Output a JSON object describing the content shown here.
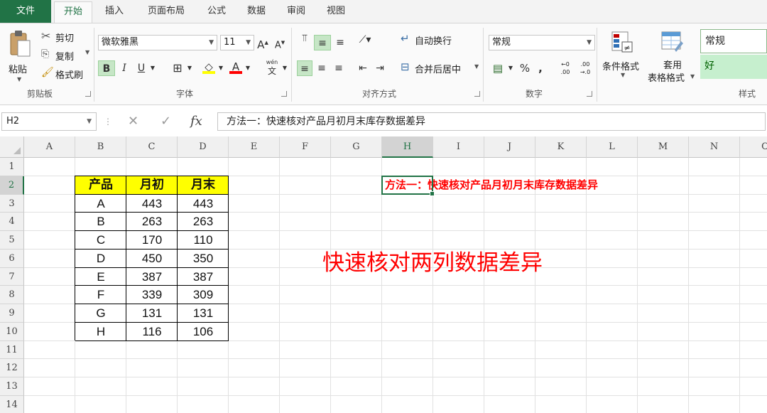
{
  "ribbon_tabs": [
    {
      "label": "文件"
    },
    {
      "label": "开始"
    },
    {
      "label": "插入"
    },
    {
      "label": "页面布局"
    },
    {
      "label": "公式"
    },
    {
      "label": "数据"
    },
    {
      "label": "审阅"
    },
    {
      "label": "视图"
    }
  ],
  "active_tab": "开始",
  "clipboard": {
    "paste": "粘贴",
    "cut": "剪切",
    "copy": "复制",
    "format_painter": "格式刷",
    "group": "剪贴板"
  },
  "font": {
    "name": "微软雅黑",
    "size": "11",
    "grow": "A",
    "shrink": "A",
    "bold": "B",
    "italic": "I",
    "underline": "U",
    "font_color_glyph": "A",
    "phonetic_top": "wén",
    "phonetic_bottom": "文",
    "group": "字体"
  },
  "alignment": {
    "wrap_text": "自动换行",
    "merge_center": "合并后居中",
    "group": "对齐方式"
  },
  "number": {
    "format": "常规",
    "percent": "%",
    "comma": ",",
    "inc_decimal_top": "←0",
    "inc_decimal_bottom": ".00",
    "dec_decimal_top": ".00",
    "dec_decimal_bottom": "→.0",
    "group": "数字"
  },
  "styles": {
    "conditional_format": "条件格式",
    "format_table_1": "套用",
    "format_table_2": "表格格式",
    "style_normal": "常规",
    "style_good": "好",
    "group": "样式"
  },
  "formula_bar": {
    "name_box": "H2",
    "cancel": "✕",
    "enter": "✓",
    "fx": "fx",
    "content": "方法一：快速核对产品月初月末库存数据差异"
  },
  "columns": [
    "A",
    "B",
    "C",
    "D",
    "E",
    "F",
    "G",
    "H",
    "I",
    "J",
    "K",
    "L",
    "M",
    "N",
    "O"
  ],
  "rows": [
    "1",
    "2",
    "3",
    "4",
    "5",
    "6",
    "7",
    "8",
    "9",
    "10",
    "11",
    "12",
    "13",
    "14"
  ],
  "selected_column": "H",
  "selected_row": "2",
  "table": {
    "headers": [
      "产品",
      "月初",
      "月末"
    ],
    "rows": [
      [
        "A",
        "443",
        "443"
      ],
      [
        "B",
        "263",
        "263"
      ],
      [
        "C",
        "170",
        "110"
      ],
      [
        "D",
        "450",
        "350"
      ],
      [
        "E",
        "387",
        "387"
      ],
      [
        "F",
        "339",
        "309"
      ],
      [
        "G",
        "131",
        "131"
      ],
      [
        "H",
        "116",
        "106"
      ]
    ]
  },
  "cell_h2": "方法一：快速核对产品月初月末库存数据差异",
  "overlay_text": "快速核对两列数据差异",
  "colors": {
    "accent": "#217346",
    "header_fill": "#ffff00",
    "red_text": "#ff0000",
    "good_style_bg": "#c6efce",
    "good_style_text": "#006100"
  }
}
